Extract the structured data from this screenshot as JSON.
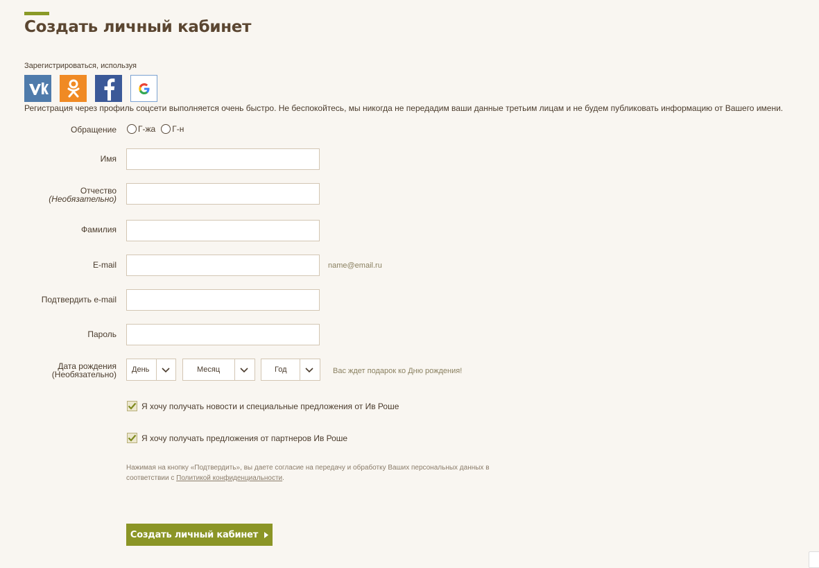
{
  "page": {
    "title": "Создать личный кабинет"
  },
  "social": {
    "caption": "Зарегистрироваться, используя",
    "icons": [
      "vk-icon",
      "odnoklassniki-icon",
      "facebook-icon",
      "google-icon"
    ],
    "note": "Регистрация через профиль соцсети выполняется очень быстро. Не беспокойтесь, мы никогда не передадим ваши данные третьим лицам и не будем публиковать информацию от Вашего имени."
  },
  "form": {
    "salutation": {
      "label": "Обращение",
      "options": [
        "Г-жа",
        "Г-н"
      ]
    },
    "first_name": {
      "label": "Имя",
      "value": ""
    },
    "patronymic": {
      "label": "Отчество",
      "optional_note": "(Необязательно)",
      "value": ""
    },
    "last_name": {
      "label": "Фамилия",
      "value": ""
    },
    "email": {
      "label": "E-mail",
      "value": "",
      "hint": "name@email.ru"
    },
    "confirm_email": {
      "label": "Подтвердить e-mail",
      "value": ""
    },
    "password": {
      "label": "Пароль",
      "value": ""
    },
    "birthdate": {
      "label_line1": "Дата рождения",
      "label_line2": "(Необязательно)",
      "day": "День",
      "month": "Месяц",
      "year": "Год",
      "hint": "Вас ждет подарок ко Дню рождения!"
    },
    "checkboxes": [
      {
        "label": "Я хочу получать новости и специальные предложения от Ив Роше",
        "checked": true
      },
      {
        "label": "Я хочу получать предложения от партнеров Ив Роше",
        "checked": true
      }
    ],
    "consent_text": "Нажимая на кнопку «Подтвердить», вы даете согласие на передачу и обработку Ваших персональных данных в соответствии с ",
    "consent_link": "Политикой конфиденциальности",
    "consent_end": ".",
    "submit_label": "Создать личный кабинет"
  },
  "colors": {
    "background": "#f9f6f1",
    "accent": "#8a9a27",
    "title": "#5b4631",
    "input_border": "#d3c6b3",
    "vk": "#4f7bab",
    "ok": "#f08a24",
    "facebook": "#3b5998"
  }
}
